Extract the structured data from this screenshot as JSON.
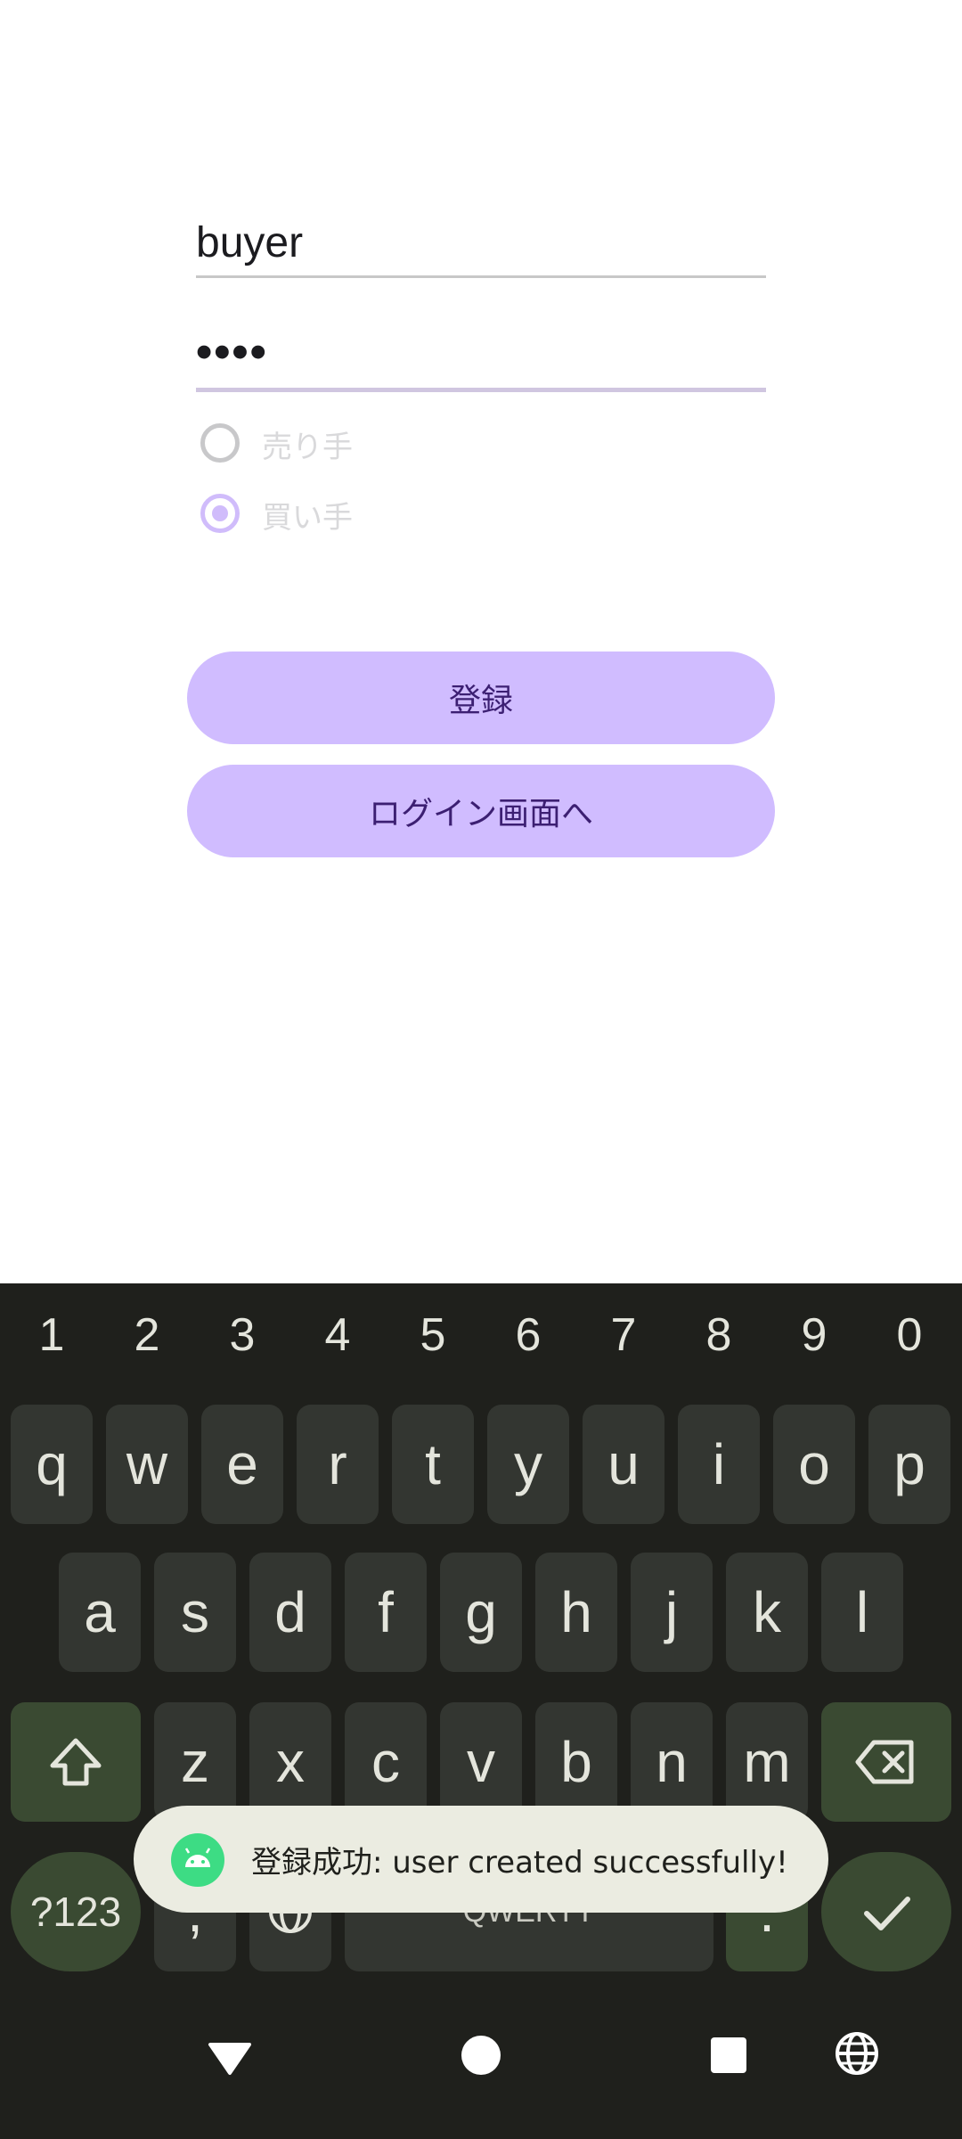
{
  "form": {
    "username_value": "buyer",
    "password_value": "••••",
    "role_options": [
      {
        "label": "売り手",
        "selected": false
      },
      {
        "label": "買い手",
        "selected": true
      }
    ],
    "register_label": "登録",
    "to_login_label": "ログイン画面へ"
  },
  "keyboard": {
    "number_row": [
      "1",
      "2",
      "3",
      "4",
      "5",
      "6",
      "7",
      "8",
      "9",
      "0"
    ],
    "row1": [
      "q",
      "w",
      "e",
      "r",
      "t",
      "y",
      "u",
      "i",
      "o",
      "p"
    ],
    "row2": [
      "a",
      "s",
      "d",
      "f",
      "g",
      "h",
      "j",
      "k",
      "l"
    ],
    "row3": [
      "z",
      "x",
      "c",
      "v",
      "b",
      "n",
      "m"
    ],
    "symbols_label": "?123",
    "comma_label": ",",
    "space_label": "QWERTY",
    "period_label": "."
  },
  "toast": {
    "message": "登録成功: user created successfully!"
  },
  "colors": {
    "accent": "#d0bcff",
    "accent_text": "#3c1f72",
    "keyboard_bg": "#1f201c",
    "key_bg": "#333631",
    "mod_key_bg": "#3a4a32",
    "toast_bg": "#ebece1"
  }
}
